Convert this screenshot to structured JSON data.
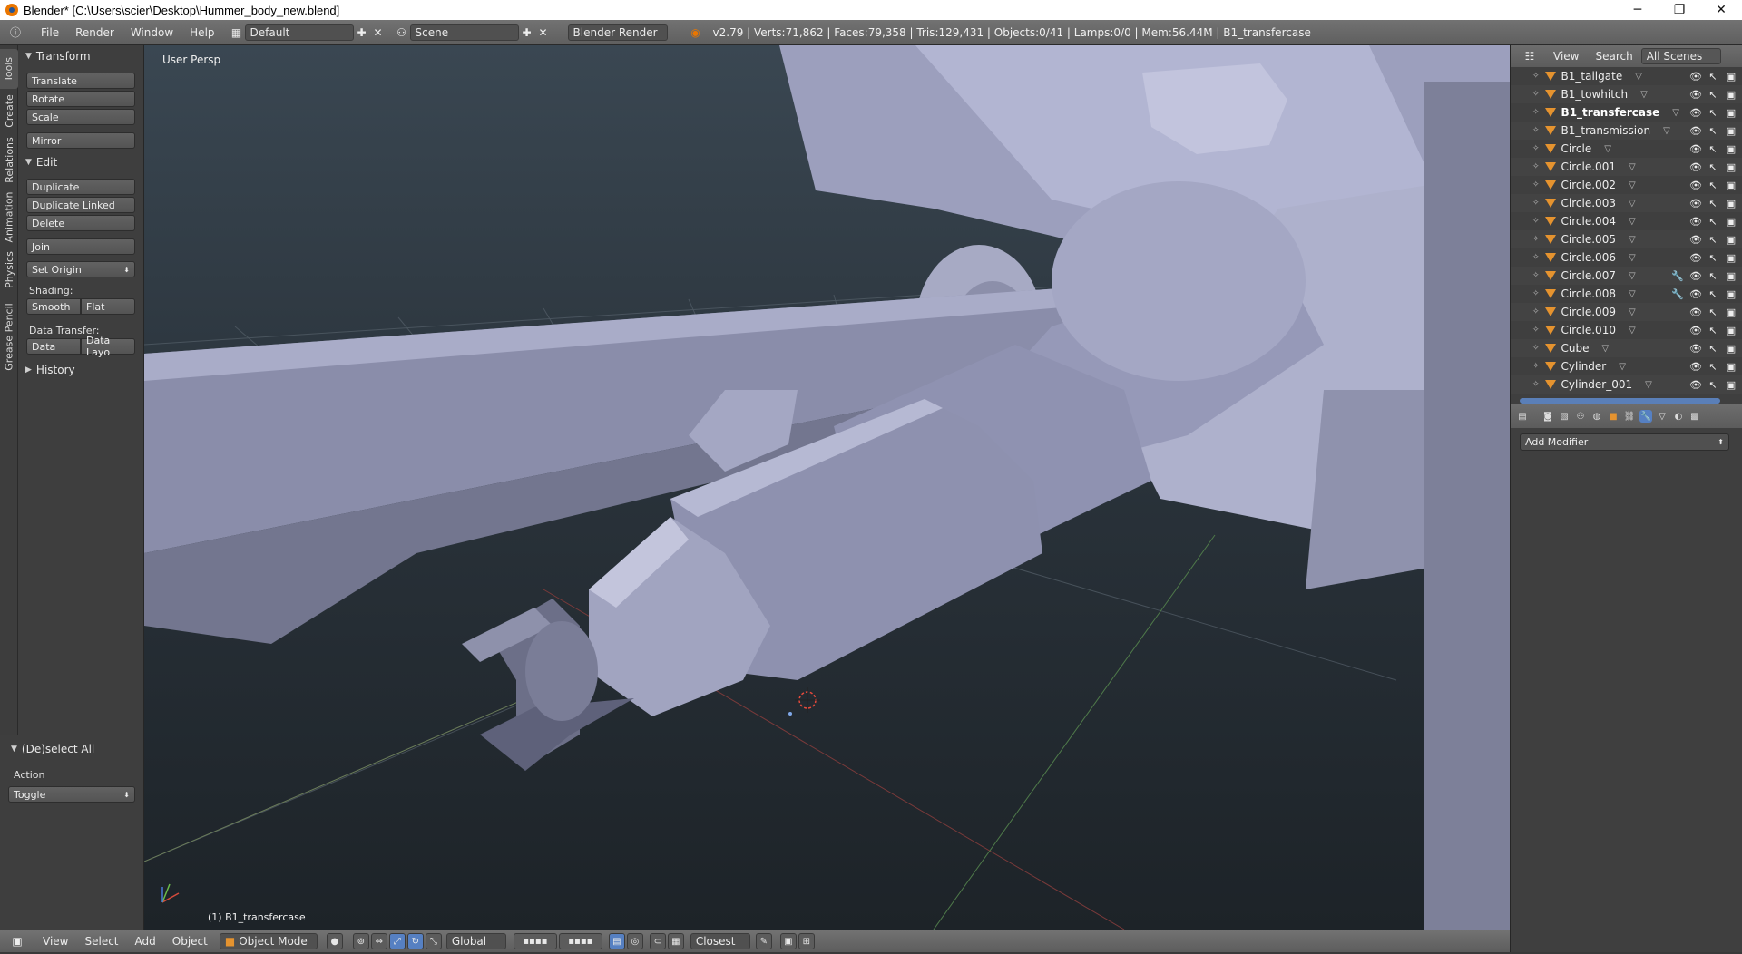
{
  "window": {
    "title": "Blender* [C:\\Users\\scier\\Desktop\\Hummer_body_new.blend]",
    "minimize": "─",
    "restore": "❐",
    "close": "✕"
  },
  "topbar": {
    "menus": [
      "File",
      "Render",
      "Window",
      "Help"
    ],
    "layout": "Default",
    "scene": "Scene",
    "engine": "Blender Render",
    "stats": "v2.79 | Verts:71,862 | Faces:79,358 | Tris:129,431 | Objects:0/41 | Lamps:0/0 | Mem:56.44M | B1_transfercase"
  },
  "tool_tabs": [
    "Tools",
    "Create",
    "Relations",
    "Animation",
    "Physics",
    "Grease Pencil"
  ],
  "tool_shelf": {
    "transform": {
      "title": "Transform",
      "buttons": [
        "Translate",
        "Rotate",
        "Scale",
        "Mirror"
      ]
    },
    "edit": {
      "title": "Edit",
      "buttons": [
        "Duplicate",
        "Duplicate Linked",
        "Delete",
        "Join"
      ],
      "set_origin": "Set Origin",
      "shading_label": "Shading:",
      "smooth": "Smooth",
      "flat": "Flat",
      "data_transfer_label": "Data Transfer:",
      "data": "Data",
      "data_layout": "Data Layo"
    },
    "history": {
      "title": "History"
    }
  },
  "operator_panel": {
    "title": "(De)select All",
    "action_label": "Action",
    "action_value": "Toggle"
  },
  "viewport": {
    "view_name": "User Persp",
    "active_object": "(1) B1_transfercase"
  },
  "bottombar": {
    "menus": [
      "View",
      "Select",
      "Add",
      "Object"
    ],
    "mode": "Object Mode",
    "orientation": "Global",
    "snap_target": "Closest"
  },
  "outliner": {
    "header": {
      "view": "View",
      "search": "Search",
      "filter": "All Scenes"
    },
    "items": [
      {
        "name": "B1_tailgate"
      },
      {
        "name": "B1_towhitch"
      },
      {
        "name": "B1_transfercase",
        "selected": true
      },
      {
        "name": "B1_transmission"
      },
      {
        "name": "Circle"
      },
      {
        "name": "Circle.001"
      },
      {
        "name": "Circle.002"
      },
      {
        "name": "Circle.003"
      },
      {
        "name": "Circle.004"
      },
      {
        "name": "Circle.005"
      },
      {
        "name": "Circle.006"
      },
      {
        "name": "Circle.007",
        "modifier": true
      },
      {
        "name": "Circle.008",
        "modifier": true
      },
      {
        "name": "Circle.009"
      },
      {
        "name": "Circle.010"
      },
      {
        "name": "Cube"
      },
      {
        "name": "Cylinder"
      },
      {
        "name": "Cylinder_001"
      }
    ]
  },
  "properties": {
    "add_modifier": "Add Modifier"
  },
  "colors": {
    "panel_bg": "#3e3e3e",
    "header_bg": "#6a6a6a",
    "accent_blue": "#5680c2",
    "mesh_tri": "#e5932f"
  }
}
